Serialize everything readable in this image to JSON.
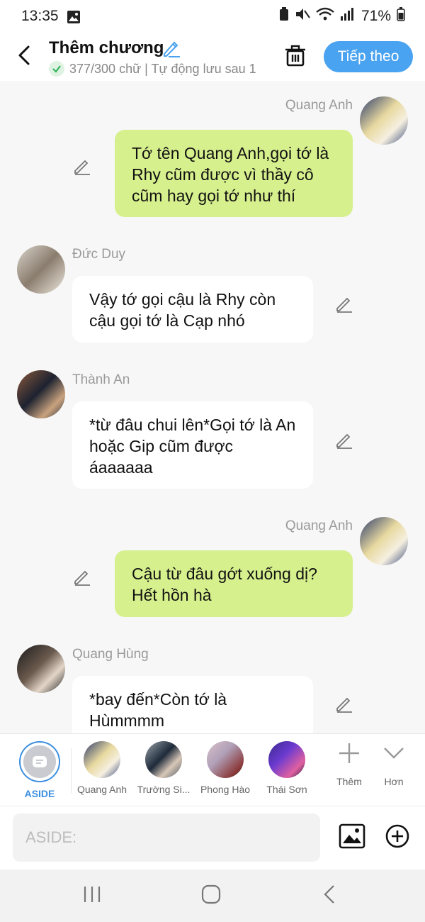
{
  "status": {
    "time": "13:35",
    "battery": "71%"
  },
  "header": {
    "title": "Thêm chương",
    "subtitle": "377/300 chữ | Tự động lưu sau 1",
    "next_label": "Tiếp theo"
  },
  "messages": [
    {
      "author": "Quang Anh",
      "side": "right",
      "text": "Tớ tên Quang Anh,gọi tớ là Rhy cũm được vì thầy cô cũm hay gọi tớ như thí"
    },
    {
      "author": "Đức Duy",
      "side": "left",
      "text": "Vậy tớ gọi cậu là Rhy còn cậu gọi tớ là Cạp nhó"
    },
    {
      "author": "Thành An",
      "side": "left",
      "text": "*từ đâu chui lên*Gọi tớ là An hoặc Gip cũm được áaaaaaa"
    },
    {
      "author": "Quang Anh",
      "side": "right",
      "text": "Cậu từ đâu gớt xuống dị? Hết hồn hà"
    },
    {
      "author": "Quang Hùng",
      "side": "left",
      "text": "*bay đến*Còn tớ là Hùmmmm"
    }
  ],
  "characters": [
    {
      "label": "ASIDE"
    },
    {
      "label": "Quang Anh"
    },
    {
      "label": "Trường Si..."
    },
    {
      "label": "Phong Hào"
    },
    {
      "label": "Thái Sơn"
    }
  ],
  "controls": {
    "more_label": "Thêm",
    "less_label": "Hơn"
  },
  "input": {
    "placeholder": "ASIDE:"
  },
  "colors": {
    "accent": "#4aa3f0",
    "bubble_green": "#d7f08e",
    "bubble_white": "#ffffff"
  }
}
